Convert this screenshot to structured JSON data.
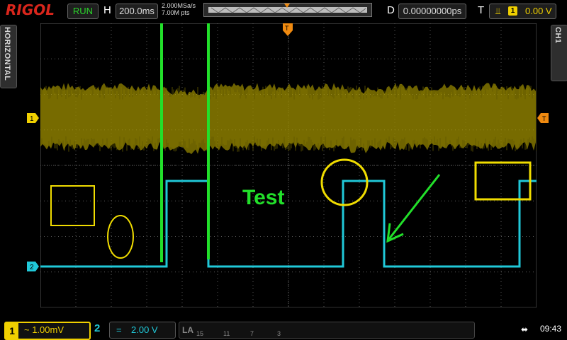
{
  "header": {
    "brand": "RIGOL",
    "run_status": "RUN",
    "horizontal_label": "H",
    "timebase": "200.0ms",
    "sample_rate": "2.000MSa/s",
    "memory_depth": "7.00M pts",
    "delay_label": "D",
    "delay": "0.00000000ps",
    "trigger_label": "T",
    "trigger_source": "1",
    "trigger_level": "0.00 V"
  },
  "side": {
    "left_tab": "HORIZONTAL",
    "right_tab": "CH1"
  },
  "screen": {
    "annotation_text": "Test",
    "ch1_marker": "1",
    "ch2_marker": "2",
    "trigger_marker": "T",
    "colors": {
      "ch1": "#c8b400",
      "ch2": "#20c8d8",
      "annotation_green": "#22e02a",
      "annotation_yellow": "#f0dc00",
      "grid": "#5a5a5a"
    }
  },
  "footer": {
    "ch1_number": "1",
    "ch1_scale": "~ 1.00mV",
    "ch2_number": "2",
    "ch2_coupling": "=",
    "ch2_scale": "2.00 V",
    "la_label": "LA",
    "la_digits": [
      "15",
      "11",
      "7",
      "3"
    ],
    "usb_icon": "usb-icon",
    "clock": "09:43"
  }
}
